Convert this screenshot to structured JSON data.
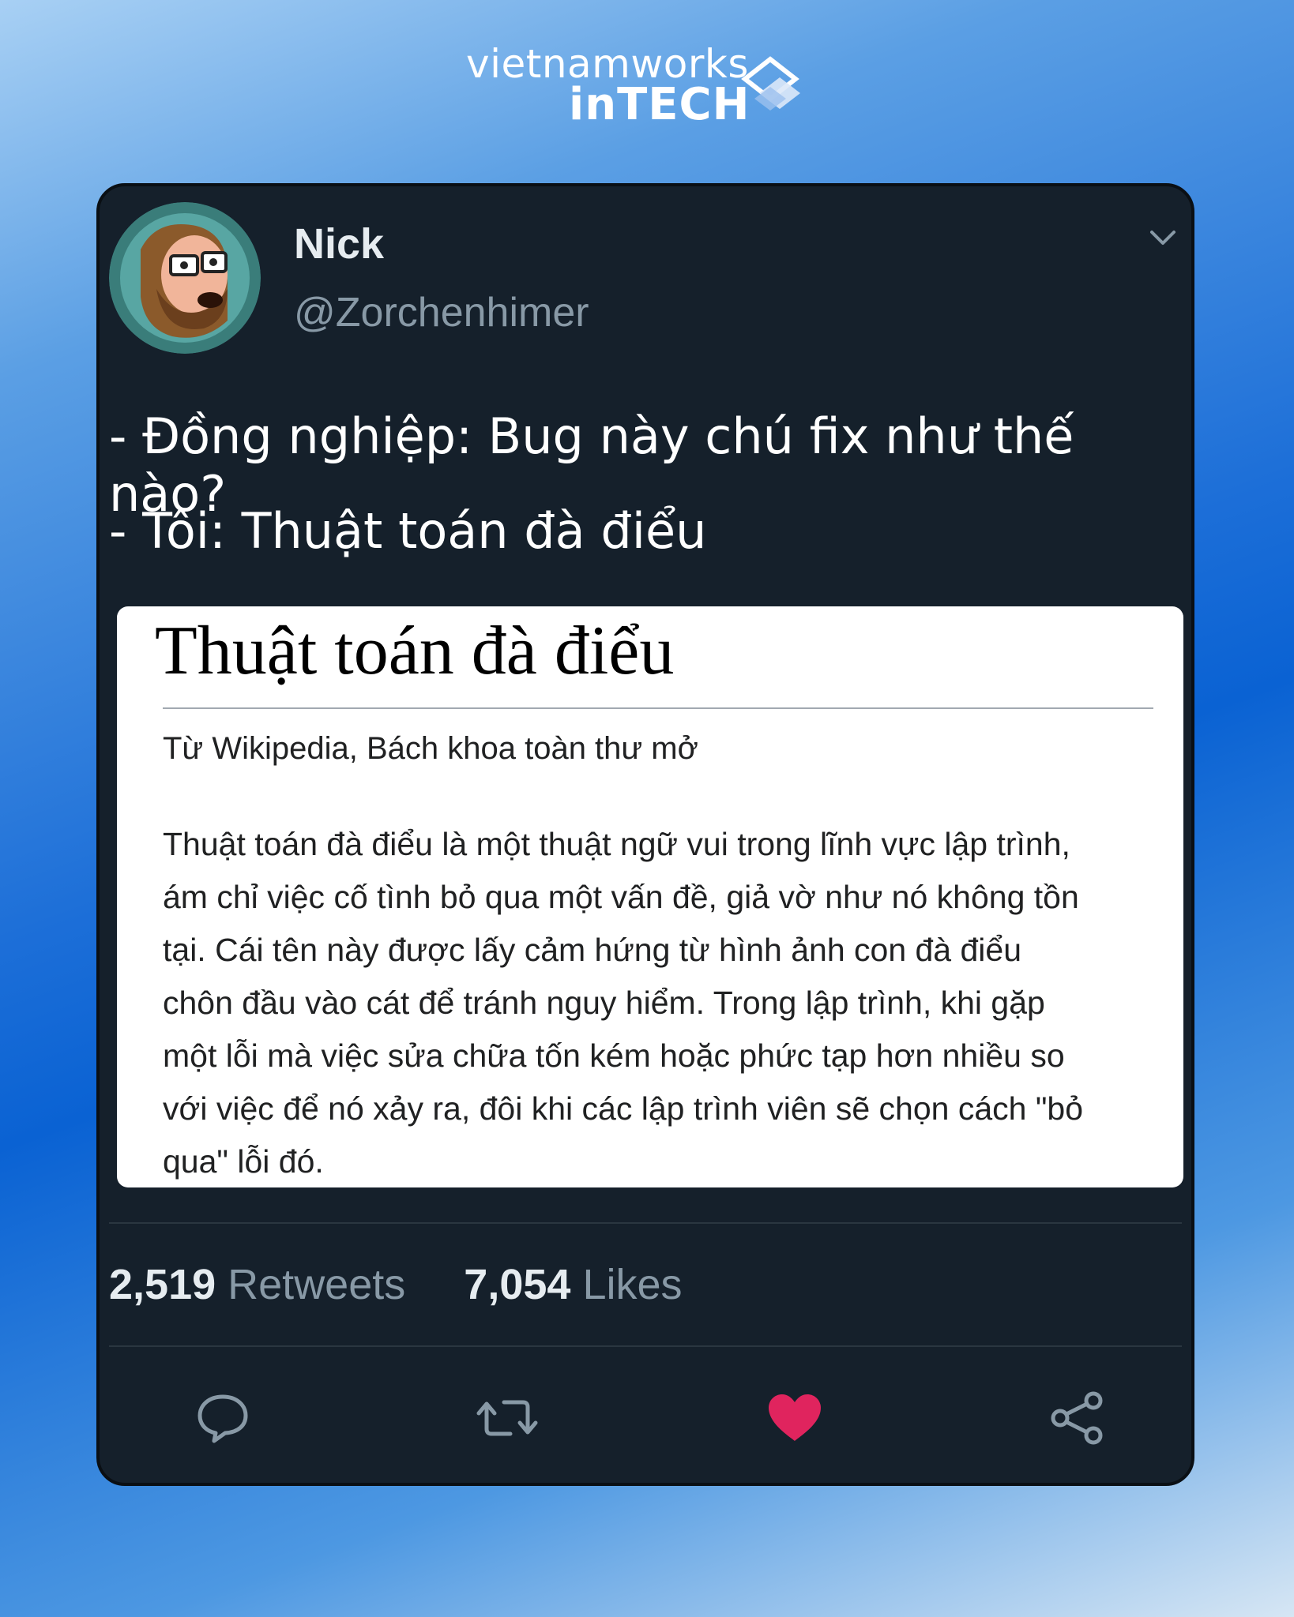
{
  "brand": {
    "line1": "vietnamworks",
    "line2": "inTECH",
    "logo_icon": "diamond-stack-icon"
  },
  "tweet": {
    "author_name": "Nick",
    "author_handle": "@Zorchenhimer",
    "menu_icon": "chevron-down-icon",
    "text_lines": [
      "- Đồng nghiệp: Bug này chú fix như thế nào?",
      "- Tôi: Thuật toán đà điểu"
    ],
    "retweets_count": "2,519",
    "retweets_label": "Retweets",
    "likes_count": "7,054",
    "likes_label": "Likes",
    "actions": [
      {
        "name": "reply",
        "icon": "comment-icon"
      },
      {
        "name": "retweet",
        "icon": "retweet-icon"
      },
      {
        "name": "like",
        "icon": "heart-icon",
        "active": true
      },
      {
        "name": "share",
        "icon": "share-icon"
      }
    ]
  },
  "wiki": {
    "title": "Thuật toán đà điểu",
    "subtitle": "Từ Wikipedia, Bách khoa toàn thư mở",
    "body_lines": [
      "Thuật toán đà điểu là một thuật ngữ vui trong lĩnh vực lập trình,",
      "ám chỉ việc cố tình bỏ qua một vấn đề, giả vờ như nó không tồn",
      "tại. Cái tên này được lấy cảm hứng từ hình ảnh con đà điểu",
      "chôn đầu vào cát để tránh nguy hiểm. Trong lập trình, khi gặp",
      "một lỗi mà việc sửa chữa tốn kém hoặc phức tạp hơn nhiều so",
      "với việc để nó xảy ra, đôi khi các lập trình viên sẽ chọn cách \"bỏ",
      "qua\" lỗi đó."
    ]
  },
  "colors": {
    "card_bg": "#15202b",
    "like_active": "#e0245e",
    "muted_text": "#8899a6",
    "icon_gray": "#8899a6"
  }
}
